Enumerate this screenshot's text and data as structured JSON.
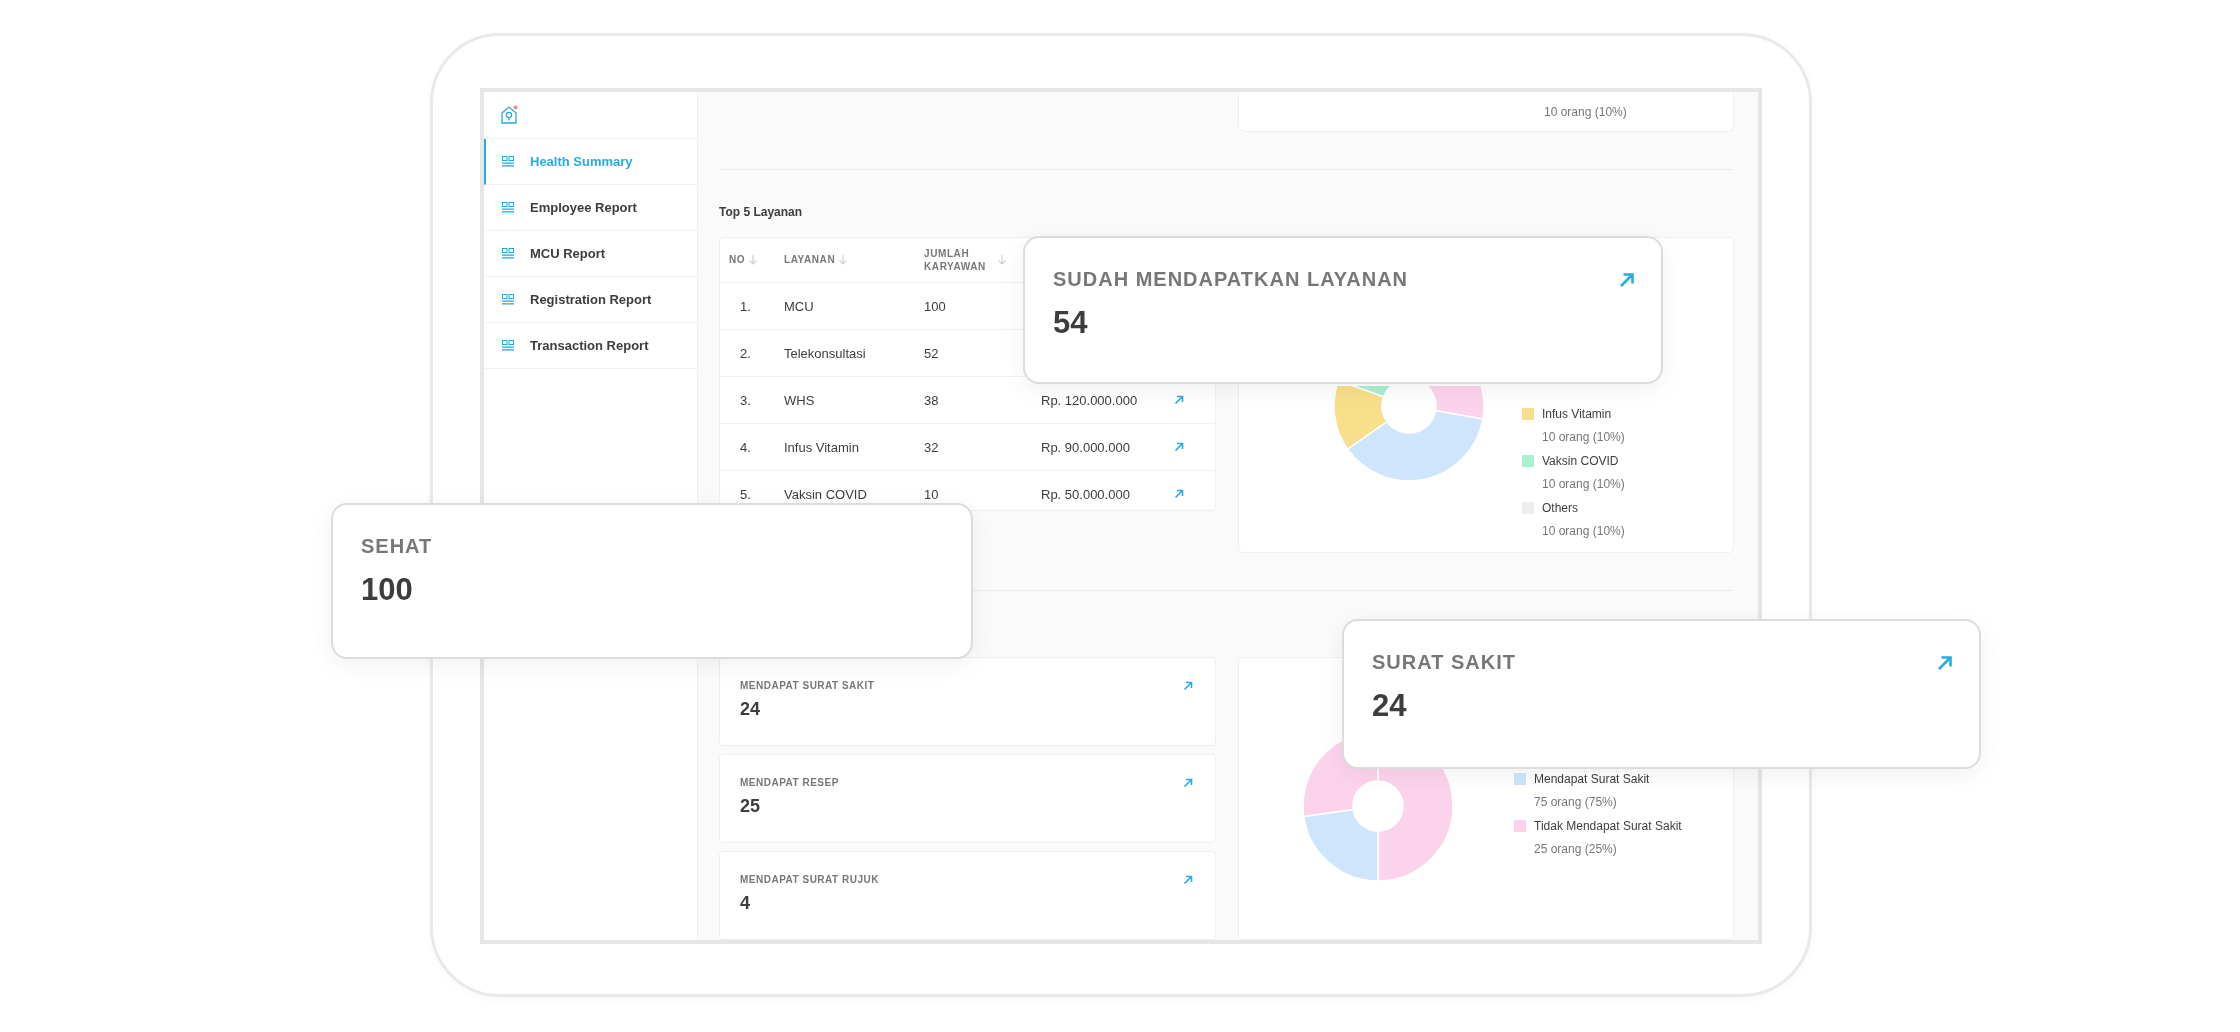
{
  "sidebar": {
    "items": [
      {
        "label": "Health Summary",
        "selected": true
      },
      {
        "label": "Employee Report",
        "selected": false
      },
      {
        "label": "MCU Report",
        "selected": false
      },
      {
        "label": "Registration Report",
        "selected": false
      },
      {
        "label": "Transaction Report",
        "selected": false
      }
    ]
  },
  "summary_card": {
    "legend_value": "10 orang (10%)"
  },
  "top_layanan": {
    "title": "Top 5 Layanan",
    "columns": [
      "NO",
      "LAYANAN",
      "JUMLAH KARYAWAN"
    ],
    "rows": [
      {
        "no": "1.",
        "layanan": "MCU",
        "jumlah": "100"
      },
      {
        "no": "2.",
        "layanan": "Telekonsultasi",
        "jumlah": "52"
      },
      {
        "no": "3.",
        "layanan": "WHS",
        "jumlah": "38",
        "biaya": "Rp. 120.000.000"
      },
      {
        "no": "4.",
        "layanan": "Infus Vitamin",
        "jumlah": "32",
        "biaya": "Rp. 90.000.000"
      },
      {
        "no": "5.",
        "layanan": "Vaksin COVID",
        "jumlah": "10",
        "biaya": "Rp. 50.000.000"
      }
    ]
  },
  "services_chart": {
    "legend": [
      {
        "label": "Infus Vitamin",
        "value": "10 orang (10%)",
        "color": "#f7df8c"
      },
      {
        "label": "Vaksin COVID",
        "value": "10 orang (10%)",
        "color": "#a8f0d0"
      },
      {
        "label": "Others",
        "value": "10 orang (10%)",
        "color": "#eeeeee"
      }
    ]
  },
  "stat_cards": [
    {
      "label": "MENDAPAT SURAT SAKIT",
      "value": "24"
    },
    {
      "label": "MENDAPAT RESEP",
      "value": "25"
    },
    {
      "label": "MENDAPAT SURAT RUJUK",
      "value": "4"
    }
  ],
  "sick_letter_chart": {
    "legend": [
      {
        "label": "Mendapat Surat Sakit",
        "value": "75 orang (75%)",
        "color": "#cfe5fb"
      },
      {
        "label": "Tidak Mendapat Surat Sakit",
        "value": "25 orang (25%)",
        "color": "#fcd3ec"
      }
    ]
  },
  "floating_cards": [
    {
      "label": "SUDAH MENDAPATKAN LAYANAN",
      "value": "54",
      "link": true
    },
    {
      "label": "SEHAT",
      "value": "100",
      "link": false
    },
    {
      "label": "SURAT SAKIT",
      "value": "24",
      "link": true
    }
  ]
}
